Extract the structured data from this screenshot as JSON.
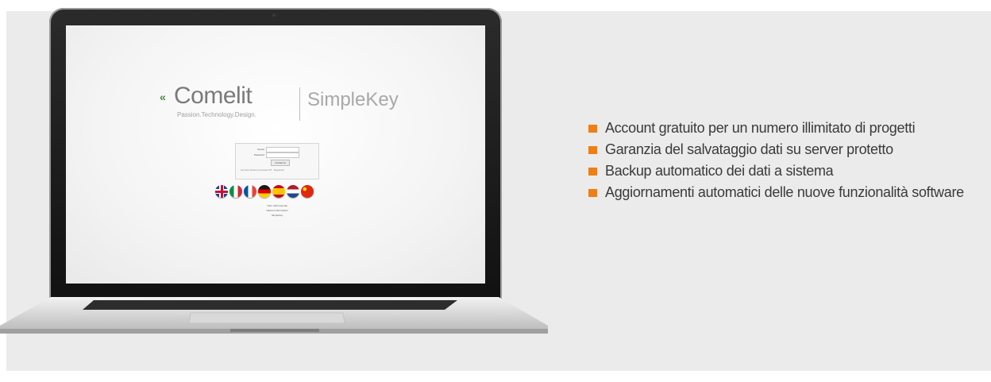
{
  "screen": {
    "brand_arrows": "«",
    "brand": "Comelit",
    "tagline": "Passion.Technology.Design.",
    "product": "SimpleKey",
    "login": {
      "username_label": "Utente",
      "password_label": "Password",
      "submit_label": "Conferma",
      "footer": "Hai dimenticato la password? · Registrati"
    },
    "flags": [
      {
        "name": "flag-uk-icon",
        "colors": [
          "#1f3f8f",
          "#ffffff",
          "#c8102e"
        ]
      },
      {
        "name": "flag-italy-icon",
        "colors": [
          "#009246",
          "#ffffff",
          "#ce2b37"
        ]
      },
      {
        "name": "flag-france-icon",
        "colors": [
          "#0055a4",
          "#ffffff",
          "#ef4135"
        ]
      },
      {
        "name": "flag-germany-icon",
        "colors": [
          "#1a1a1a",
          "#dd0000",
          "#ffce00"
        ]
      },
      {
        "name": "flag-spain-icon",
        "colors": [
          "#c60b1e",
          "#ffc400",
          "#c60b1e"
        ]
      },
      {
        "name": "flag-netherlands-icon",
        "colors": [
          "#ae1c28",
          "#ffffff",
          "#21468b"
        ]
      },
      {
        "name": "flag-china-icon",
        "colors": [
          "#de2910",
          "#de2910",
          "#de2910"
        ]
      }
    ],
    "footer_lines": [
      "Tutti i diritti riservati",
      "Ulteriori informazioni",
      "SimpleKey"
    ]
  },
  "features": [
    "Account gratuito per un numero illimitato di progetti",
    "Garanzia del salvataggio dati su server protetto",
    "Backup automatico dei dati a sistema",
    "Aggiornamenti automatici delle nuove funzionalità software"
  ],
  "colors": {
    "bullet": "#f07e16",
    "panel": "#ebebeb",
    "text": "#3a3a3a",
    "brand_green": "#3b8e3a"
  }
}
